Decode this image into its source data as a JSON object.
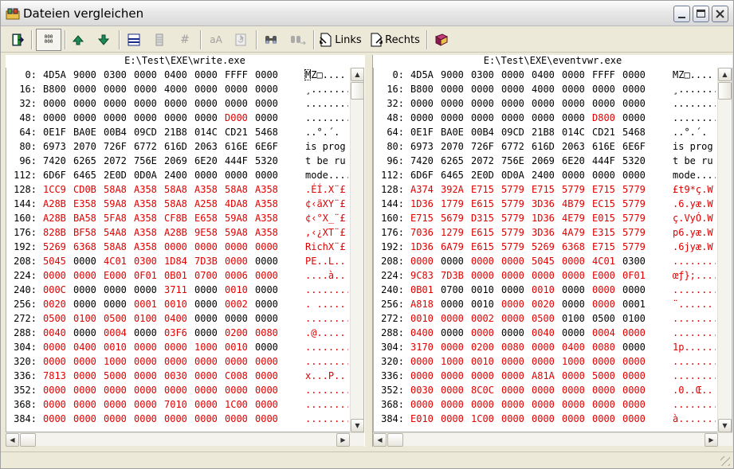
{
  "window": {
    "title": "Dateien vergleichen"
  },
  "toolbar": {
    "links_label": "Links",
    "rechts_label": "Rechts",
    "hex_label": "000",
    "case_label": "aA",
    "hash_label": "#"
  },
  "left": {
    "path": "E:\\Test\\EXE\\write.exe",
    "rows": [
      {
        "addr": "0:",
        "words": [
          "4D5A",
          "9000",
          "0300",
          "0000",
          "0400",
          "0000",
          "FFFF",
          "0000"
        ],
        "ascii": "MZ□....",
        "d": [
          0,
          0,
          0,
          0,
          0,
          0,
          0,
          0,
          0
        ]
      },
      {
        "addr": "16:",
        "words": [
          "B800",
          "0000",
          "0000",
          "0000",
          "4000",
          "0000",
          "0000",
          "0000"
        ],
        "ascii": "¸.......",
        "d": [
          0,
          0,
          0,
          0,
          0,
          0,
          0,
          0,
          0
        ]
      },
      {
        "addr": "32:",
        "words": [
          "0000",
          "0000",
          "0000",
          "0000",
          "0000",
          "0000",
          "0000",
          "0000"
        ],
        "ascii": "........",
        "d": [
          0,
          0,
          0,
          0,
          0,
          0,
          0,
          0,
          0
        ]
      },
      {
        "addr": "48:",
        "words": [
          "0000",
          "0000",
          "0000",
          "0000",
          "0000",
          "0000",
          "D000",
          "0000"
        ],
        "ascii": "........",
        "d": [
          0,
          0,
          0,
          0,
          0,
          0,
          1,
          0,
          0
        ]
      },
      {
        "addr": "64:",
        "words": [
          "0E1F",
          "BA0E",
          "00B4",
          "09CD",
          "21B8",
          "014C",
          "CD21",
          "5468"
        ],
        "ascii": "..°.´.",
        "d": [
          0,
          0,
          0,
          0,
          0,
          0,
          0,
          0,
          0
        ]
      },
      {
        "addr": "80:",
        "words": [
          "6973",
          "2070",
          "726F",
          "6772",
          "616D",
          "2063",
          "616E",
          "6E6F"
        ],
        "ascii": "is prog",
        "d": [
          0,
          0,
          0,
          0,
          0,
          0,
          0,
          0,
          0
        ]
      },
      {
        "addr": "96:",
        "words": [
          "7420",
          "6265",
          "2072",
          "756E",
          "2069",
          "6E20",
          "444F",
          "5320"
        ],
        "ascii": "t be ru",
        "d": [
          0,
          0,
          0,
          0,
          0,
          0,
          0,
          0,
          0
        ]
      },
      {
        "addr": "112:",
        "words": [
          "6D6F",
          "6465",
          "2E0D",
          "0D0A",
          "2400",
          "0000",
          "0000",
          "0000"
        ],
        "ascii": "mode....",
        "d": [
          0,
          0,
          0,
          0,
          0,
          0,
          0,
          0,
          0
        ]
      },
      {
        "addr": "128:",
        "words": [
          "1CC9",
          "CD0B",
          "58A8",
          "A358",
          "58A8",
          "A358",
          "58A8",
          "A358"
        ],
        "ascii": ".ÉÍ.X¨£",
        "d": [
          1,
          1,
          1,
          1,
          1,
          1,
          1,
          1,
          1
        ]
      },
      {
        "addr": "144:",
        "words": [
          "A28B",
          "E358",
          "59A8",
          "A358",
          "58A8",
          "A258",
          "4DA8",
          "A358"
        ],
        "ascii": "¢‹ãXY¨£",
        "d": [
          1,
          1,
          1,
          1,
          1,
          1,
          1,
          1,
          1
        ]
      },
      {
        "addr": "160:",
        "words": [
          "A28B",
          "BA58",
          "5FA8",
          "A358",
          "CF8B",
          "E658",
          "59A8",
          "A358"
        ],
        "ascii": "¢‹°X_¨£",
        "d": [
          1,
          1,
          1,
          1,
          1,
          1,
          1,
          1,
          1
        ]
      },
      {
        "addr": "176:",
        "words": [
          "828B",
          "BF58",
          "54A8",
          "A358",
          "A28B",
          "9E58",
          "59A8",
          "A358"
        ],
        "ascii": "‚‹¿XT¨£",
        "d": [
          1,
          1,
          1,
          1,
          1,
          1,
          1,
          1,
          1
        ]
      },
      {
        "addr": "192:",
        "words": [
          "5269",
          "6368",
          "58A8",
          "A358",
          "0000",
          "0000",
          "0000",
          "0000"
        ],
        "ascii": "RichX¨£",
        "d": [
          1,
          1,
          1,
          1,
          1,
          1,
          1,
          1,
          1
        ]
      },
      {
        "addr": "208:",
        "words": [
          "5045",
          "0000",
          "4C01",
          "0300",
          "1D84",
          "7D3B",
          "0000",
          "0000"
        ],
        "ascii": "PE..L..",
        "d": [
          1,
          0,
          1,
          1,
          1,
          1,
          1,
          0,
          1
        ]
      },
      {
        "addr": "224:",
        "words": [
          "0000",
          "0000",
          "E000",
          "0F01",
          "0B01",
          "0700",
          "0006",
          "0000"
        ],
        "ascii": "....à..",
        "d": [
          1,
          1,
          1,
          1,
          1,
          1,
          1,
          1,
          1
        ]
      },
      {
        "addr": "240:",
        "words": [
          "000C",
          "0000",
          "0000",
          "0000",
          "3711",
          "0000",
          "0010",
          "0000"
        ],
        "ascii": "........",
        "d": [
          1,
          0,
          0,
          0,
          1,
          0,
          1,
          0,
          1
        ]
      },
      {
        "addr": "256:",
        "words": [
          "0020",
          "0000",
          "0000",
          "0001",
          "0010",
          "0000",
          "0002",
          "0000"
        ],
        "ascii": ". .....",
        "d": [
          1,
          0,
          0,
          1,
          1,
          0,
          1,
          0,
          1
        ]
      },
      {
        "addr": "272:",
        "words": [
          "0500",
          "0100",
          "0500",
          "0100",
          "0400",
          "0000",
          "0000",
          "0000"
        ],
        "ascii": "........",
        "d": [
          1,
          1,
          1,
          1,
          1,
          0,
          0,
          0,
          1
        ]
      },
      {
        "addr": "288:",
        "words": [
          "0040",
          "0000",
          "0004",
          "0000",
          "03F6",
          "0000",
          "0200",
          "0080"
        ],
        "ascii": ".@.....",
        "d": [
          1,
          0,
          1,
          0,
          1,
          0,
          1,
          1,
          1
        ]
      },
      {
        "addr": "304:",
        "words": [
          "0000",
          "0400",
          "0010",
          "0000",
          "0000",
          "1000",
          "0010",
          "0000"
        ],
        "ascii": "........",
        "d": [
          1,
          1,
          1,
          1,
          1,
          1,
          1,
          0,
          1
        ]
      },
      {
        "addr": "320:",
        "words": [
          "0000",
          "0000",
          "1000",
          "0000",
          "0000",
          "0000",
          "0000",
          "0000"
        ],
        "ascii": "........",
        "d": [
          1,
          1,
          1,
          1,
          1,
          1,
          1,
          1,
          1
        ]
      },
      {
        "addr": "336:",
        "words": [
          "7813",
          "0000",
          "5000",
          "0000",
          "0030",
          "0000",
          "C008",
          "0000"
        ],
        "ascii": "x...P..",
        "d": [
          1,
          1,
          1,
          1,
          1,
          1,
          1,
          1,
          1
        ]
      },
      {
        "addr": "352:",
        "words": [
          "0000",
          "0000",
          "0000",
          "0000",
          "0000",
          "0000",
          "0000",
          "0000"
        ],
        "ascii": "........",
        "d": [
          1,
          1,
          1,
          1,
          1,
          1,
          1,
          1,
          1
        ]
      },
      {
        "addr": "368:",
        "words": [
          "0000",
          "0000",
          "0000",
          "0000",
          "7010",
          "0000",
          "1C00",
          "0000"
        ],
        "ascii": "........",
        "d": [
          1,
          1,
          1,
          1,
          1,
          1,
          1,
          1,
          1
        ]
      },
      {
        "addr": "384:",
        "words": [
          "0000",
          "0000",
          "0000",
          "0000",
          "0000",
          "0000",
          "0000",
          "0000"
        ],
        "ascii": "........",
        "d": [
          1,
          1,
          1,
          1,
          1,
          1,
          1,
          1,
          1
        ]
      }
    ]
  },
  "right": {
    "path": "E:\\Test\\EXE\\eventvwr.exe",
    "rows": [
      {
        "addr": "0:",
        "words": [
          "4D5A",
          "9000",
          "0300",
          "0000",
          "0400",
          "0000",
          "FFFF",
          "0000"
        ],
        "ascii": "MZ□....",
        "d": [
          0,
          0,
          0,
          0,
          0,
          0,
          0,
          0,
          0
        ]
      },
      {
        "addr": "16:",
        "words": [
          "B800",
          "0000",
          "0000",
          "0000",
          "4000",
          "0000",
          "0000",
          "0000"
        ],
        "ascii": "¸.......",
        "d": [
          0,
          0,
          0,
          0,
          0,
          0,
          0,
          0,
          0
        ]
      },
      {
        "addr": "32:",
        "words": [
          "0000",
          "0000",
          "0000",
          "0000",
          "0000",
          "0000",
          "0000",
          "0000"
        ],
        "ascii": "........",
        "d": [
          0,
          0,
          0,
          0,
          0,
          0,
          0,
          0,
          0
        ]
      },
      {
        "addr": "48:",
        "words": [
          "0000",
          "0000",
          "0000",
          "0000",
          "0000",
          "0000",
          "D800",
          "0000"
        ],
        "ascii": "........",
        "d": [
          0,
          0,
          0,
          0,
          0,
          0,
          1,
          0,
          0
        ]
      },
      {
        "addr": "64:",
        "words": [
          "0E1F",
          "BA0E",
          "00B4",
          "09CD",
          "21B8",
          "014C",
          "CD21",
          "5468"
        ],
        "ascii": "..°.´.",
        "d": [
          0,
          0,
          0,
          0,
          0,
          0,
          0,
          0,
          0
        ]
      },
      {
        "addr": "80:",
        "words": [
          "6973",
          "2070",
          "726F",
          "6772",
          "616D",
          "2063",
          "616E",
          "6E6F"
        ],
        "ascii": "is prog",
        "d": [
          0,
          0,
          0,
          0,
          0,
          0,
          0,
          0,
          0
        ]
      },
      {
        "addr": "96:",
        "words": [
          "7420",
          "6265",
          "2072",
          "756E",
          "2069",
          "6E20",
          "444F",
          "5320"
        ],
        "ascii": "t be ru",
        "d": [
          0,
          0,
          0,
          0,
          0,
          0,
          0,
          0,
          0
        ]
      },
      {
        "addr": "112:",
        "words": [
          "6D6F",
          "6465",
          "2E0D",
          "0D0A",
          "2400",
          "0000",
          "0000",
          "0000"
        ],
        "ascii": "mode....",
        "d": [
          0,
          0,
          0,
          0,
          0,
          0,
          0,
          0,
          0
        ]
      },
      {
        "addr": "128:",
        "words": [
          "A374",
          "392A",
          "E715",
          "5779",
          "E715",
          "5779",
          "E715",
          "5779"
        ],
        "ascii": "£t9*ç.W",
        "d": [
          1,
          1,
          1,
          1,
          1,
          1,
          1,
          1,
          1
        ]
      },
      {
        "addr": "144:",
        "words": [
          "1D36",
          "1779",
          "E615",
          "5779",
          "3D36",
          "4B79",
          "EC15",
          "5779"
        ],
        "ascii": ".6.yæ.W",
        "d": [
          1,
          1,
          1,
          1,
          1,
          1,
          1,
          1,
          1
        ]
      },
      {
        "addr": "160:",
        "words": [
          "E715",
          "5679",
          "D315",
          "5779",
          "1D36",
          "4E79",
          "E015",
          "5779"
        ],
        "ascii": "ç.VyÓ.W",
        "d": [
          1,
          1,
          1,
          1,
          1,
          1,
          1,
          1,
          1
        ]
      },
      {
        "addr": "176:",
        "words": [
          "7036",
          "1279",
          "E615",
          "5779",
          "3D36",
          "4A79",
          "E315",
          "5779"
        ],
        "ascii": "p6.yæ.W",
        "d": [
          1,
          1,
          1,
          1,
          1,
          1,
          1,
          1,
          1
        ]
      },
      {
        "addr": "192:",
        "words": [
          "1D36",
          "6A79",
          "E615",
          "5779",
          "5269",
          "6368",
          "E715",
          "5779"
        ],
        "ascii": ".6jyæ.W",
        "d": [
          1,
          1,
          1,
          1,
          1,
          1,
          1,
          1,
          1
        ]
      },
      {
        "addr": "208:",
        "words": [
          "0000",
          "0000",
          "0000",
          "0000",
          "5045",
          "0000",
          "4C01",
          "0300"
        ],
        "ascii": "........",
        "d": [
          1,
          0,
          1,
          1,
          1,
          1,
          1,
          0,
          1
        ]
      },
      {
        "addr": "224:",
        "words": [
          "9C83",
          "7D3B",
          "0000",
          "0000",
          "0000",
          "0000",
          "E000",
          "0F01"
        ],
        "ascii": "œƒ};....",
        "d": [
          1,
          1,
          1,
          1,
          1,
          1,
          1,
          1,
          1
        ]
      },
      {
        "addr": "240:",
        "words": [
          "0B01",
          "0700",
          "0010",
          "0000",
          "0010",
          "0000",
          "0000",
          "0000"
        ],
        "ascii": "........",
        "d": [
          1,
          0,
          0,
          0,
          1,
          0,
          1,
          0,
          1
        ]
      },
      {
        "addr": "256:",
        "words": [
          "A818",
          "0000",
          "0010",
          "0000",
          "0020",
          "0000",
          "0000",
          "0001"
        ],
        "ascii": "¨......",
        "d": [
          1,
          0,
          0,
          1,
          1,
          0,
          1,
          0,
          1
        ]
      },
      {
        "addr": "272:",
        "words": [
          "0010",
          "0000",
          "0002",
          "0000",
          "0500",
          "0100",
          "0500",
          "0100"
        ],
        "ascii": "........",
        "d": [
          1,
          1,
          1,
          1,
          1,
          0,
          0,
          0,
          1
        ]
      },
      {
        "addr": "288:",
        "words": [
          "0400",
          "0000",
          "0000",
          "0000",
          "0040",
          "0000",
          "0004",
          "0000"
        ],
        "ascii": "........",
        "d": [
          1,
          0,
          1,
          0,
          1,
          0,
          1,
          1,
          1
        ]
      },
      {
        "addr": "304:",
        "words": [
          "3170",
          "0000",
          "0200",
          "0080",
          "0000",
          "0400",
          "0080",
          "0000"
        ],
        "ascii": "1p......",
        "d": [
          1,
          1,
          1,
          1,
          1,
          1,
          1,
          0,
          1
        ]
      },
      {
        "addr": "320:",
        "words": [
          "0000",
          "1000",
          "0010",
          "0000",
          "0000",
          "1000",
          "0000",
          "0000"
        ],
        "ascii": "........",
        "d": [
          1,
          1,
          1,
          1,
          1,
          1,
          1,
          1,
          1
        ]
      },
      {
        "addr": "336:",
        "words": [
          "0000",
          "0000",
          "0000",
          "0000",
          "A81A",
          "0000",
          "5000",
          "0000"
        ],
        "ascii": "........",
        "d": [
          1,
          1,
          1,
          1,
          1,
          1,
          1,
          1,
          1
        ]
      },
      {
        "addr": "352:",
        "words": [
          "0030",
          "0000",
          "8C0C",
          "0000",
          "0000",
          "0000",
          "0000",
          "0000"
        ],
        "ascii": ".0..Œ..",
        "d": [
          1,
          1,
          1,
          1,
          1,
          1,
          1,
          1,
          1
        ]
      },
      {
        "addr": "368:",
        "words": [
          "0000",
          "0000",
          "0000",
          "0000",
          "0000",
          "0000",
          "0000",
          "0000"
        ],
        "ascii": "........",
        "d": [
          1,
          1,
          1,
          1,
          1,
          1,
          1,
          1,
          1
        ]
      },
      {
        "addr": "384:",
        "words": [
          "E010",
          "0000",
          "1C00",
          "0000",
          "0000",
          "0000",
          "0000",
          "0000"
        ],
        "ascii": "à.......",
        "d": [
          1,
          1,
          1,
          1,
          1,
          1,
          1,
          1,
          1
        ]
      }
    ]
  },
  "colors": {
    "diff": "#e00000",
    "same": "#000000",
    "accent": "#316ac5"
  },
  "icons": [
    "exit-icon",
    "hex-view-icon",
    "prev-diff-icon",
    "next-diff-icon",
    "sync-scroll-icon",
    "line-view-icon",
    "hash-icon",
    "case-icon",
    "refresh-icon",
    "find-icon",
    "find-next-icon",
    "links-icon",
    "rechts-icon",
    "help-icon"
  ]
}
